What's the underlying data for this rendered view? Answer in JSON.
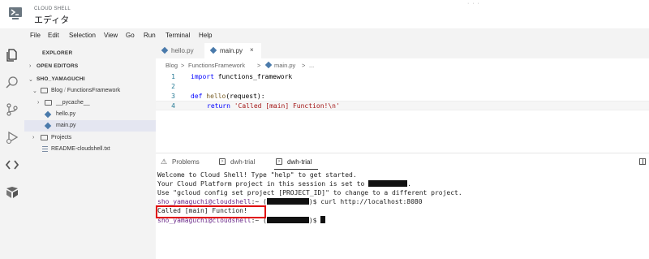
{
  "header": {
    "subtitle": "CLOUD SHELL",
    "title": "エディタ",
    "logo_icon": "cloud-shell-terminal-icon"
  },
  "menu": [
    "File",
    "Edit",
    "Selection",
    "View",
    "Go",
    "Run",
    "Terminal",
    "Help"
  ],
  "activity_bar": [
    "explorer-icon",
    "search-icon",
    "source-control-icon",
    "run-debug-icon",
    "code-icon",
    "cloud-icon"
  ],
  "sidebar": {
    "title": "EXPLORER",
    "open_editors": "OPEN EDITORS",
    "workspace": "SHO_YAMAGUCHI",
    "folder_blog": "Blog",
    "folder_blog_sub": "FunctionsFramework",
    "pycache": "__pycache__",
    "file_hello": "hello.py",
    "file_main": "main.py",
    "folder_projects": "Projects",
    "file_readme": "README-cloudshell.txt"
  },
  "tabs": [
    {
      "label": "hello.py",
      "active": false
    },
    {
      "label": "main.py",
      "active": true,
      "close": "×"
    }
  ],
  "breadcrumb": {
    "part1": "Blog",
    "sep": ">",
    "part2": "FunctionsFramework",
    "part3": "main.py",
    "part4": "..."
  },
  "code": {
    "line_numbers": [
      "1",
      "2",
      "3",
      "4"
    ],
    "l1_kw": "import",
    "l1_rest": " functions_framework",
    "l3_kw": "def",
    "l3_fn": " hello",
    "l3_rest": "(request):",
    "l4_kw": "return",
    "l4_str": "'Called [main] Function!\\n'"
  },
  "panel": {
    "tab_problems": "Problems",
    "tab_term1": "dwh-trial",
    "tab_term2": "dwh-trial",
    "terminal_icon_glyph": ">"
  },
  "terminal": {
    "line1": "Welcome to Cloud Shell! Type \"help\" to get started.",
    "line2": "Your Cloud Platform project in this session is set to",
    "line2_end": ".",
    "line3": "Use \"gcloud config set project [PROJECT_ID]\" to change to a different project.",
    "line4_user": "sho_yamaguchi@cloudshell",
    "line4_mid": ":~ (",
    "line4_end": ")$ curl http://localhost:8080",
    "line5": "Called [main] Function!",
    "line6_user": "sho_yamaguchi@cloudshell",
    "line6_mid": ":~ (",
    "line6_end": ")$ "
  },
  "colors": {
    "highlight": "#e00000",
    "keyword": "#0000ff",
    "string": "#a31515",
    "function": "#795e26"
  }
}
